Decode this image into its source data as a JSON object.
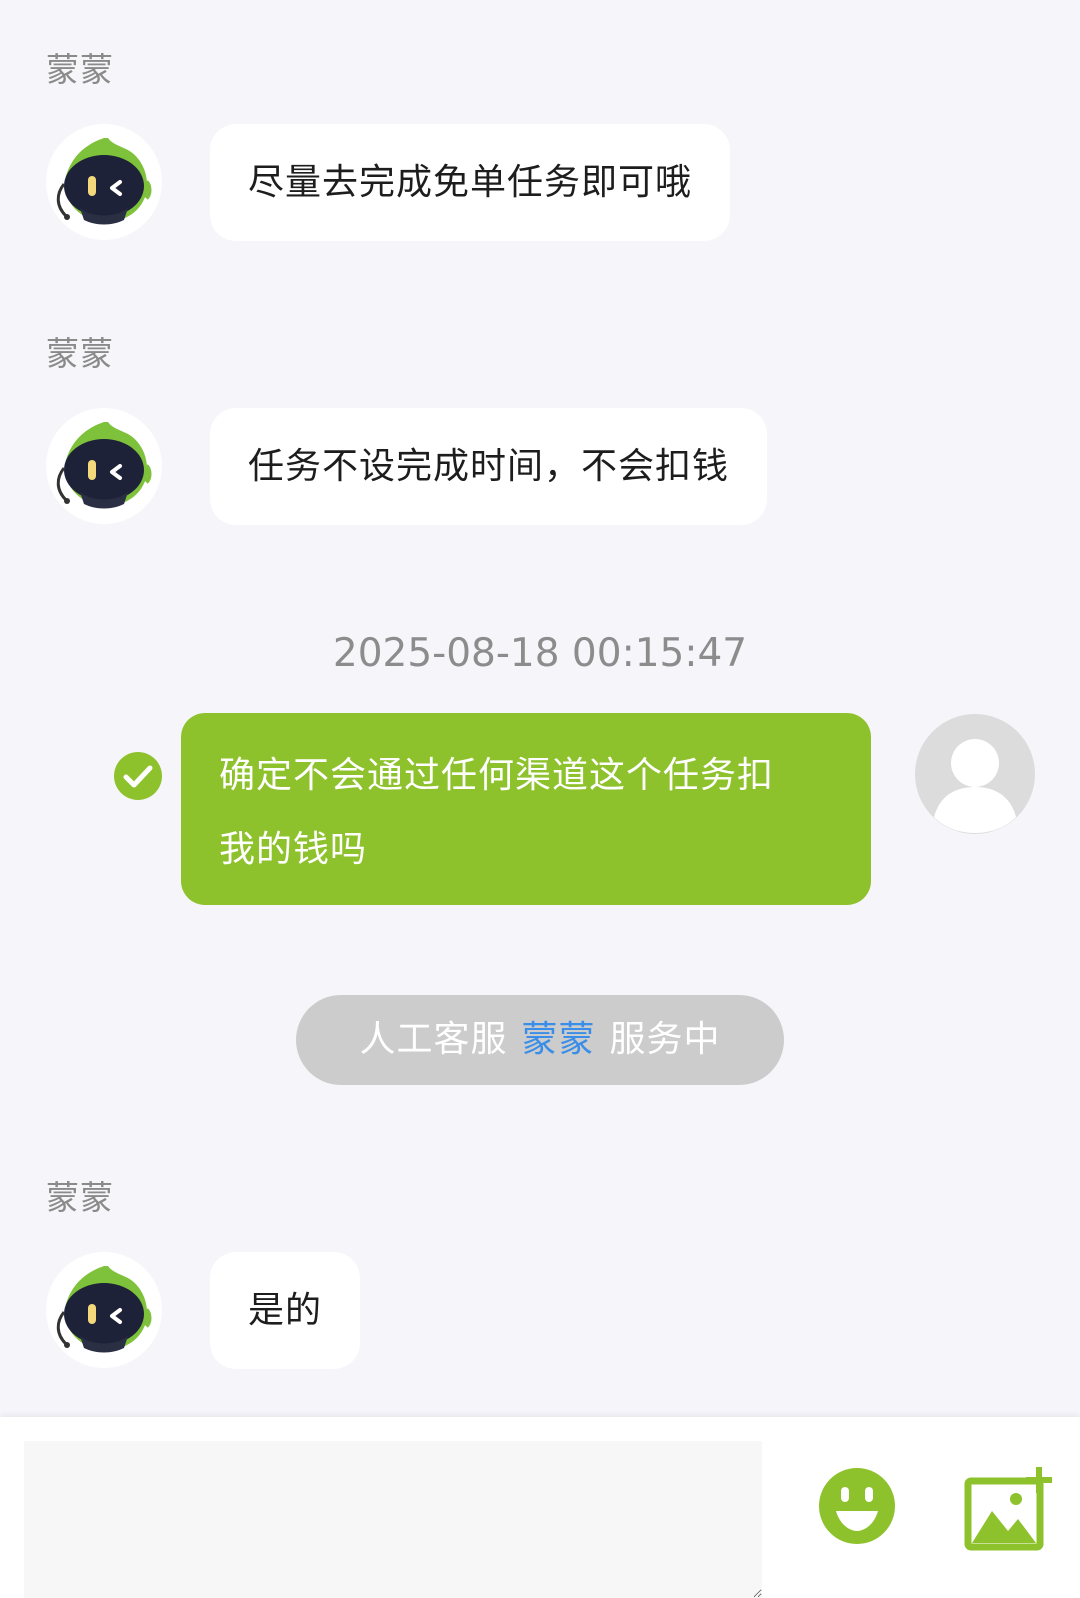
{
  "messages": [
    {
      "sender": "蒙蒙",
      "text": "尽量去完成免单任务即可哦"
    },
    {
      "sender": "蒙蒙",
      "text": "任务不设完成时间，不会扣钱"
    },
    {
      "sender": "蒙蒙",
      "text": "是的"
    }
  ],
  "timestamp": "2025-08-18 00:15:47",
  "outgoing": {
    "line1": "确定不会通过任何渠道这个任务扣",
    "line2": "我的钱吗",
    "status_icon": "check-circle-icon"
  },
  "service_banner": {
    "prefix": "人工客服",
    "agent": "蒙蒙",
    "suffix": "服务中"
  },
  "input": {
    "placeholder": "",
    "emoji_icon": "smiley-icon",
    "image_icon": "add-image-icon"
  },
  "colors": {
    "background": "#f5f5fa",
    "outgoing_bubble": "#8ec22c",
    "agent_name": "#3b8ee8",
    "pill": "#cccccc"
  }
}
